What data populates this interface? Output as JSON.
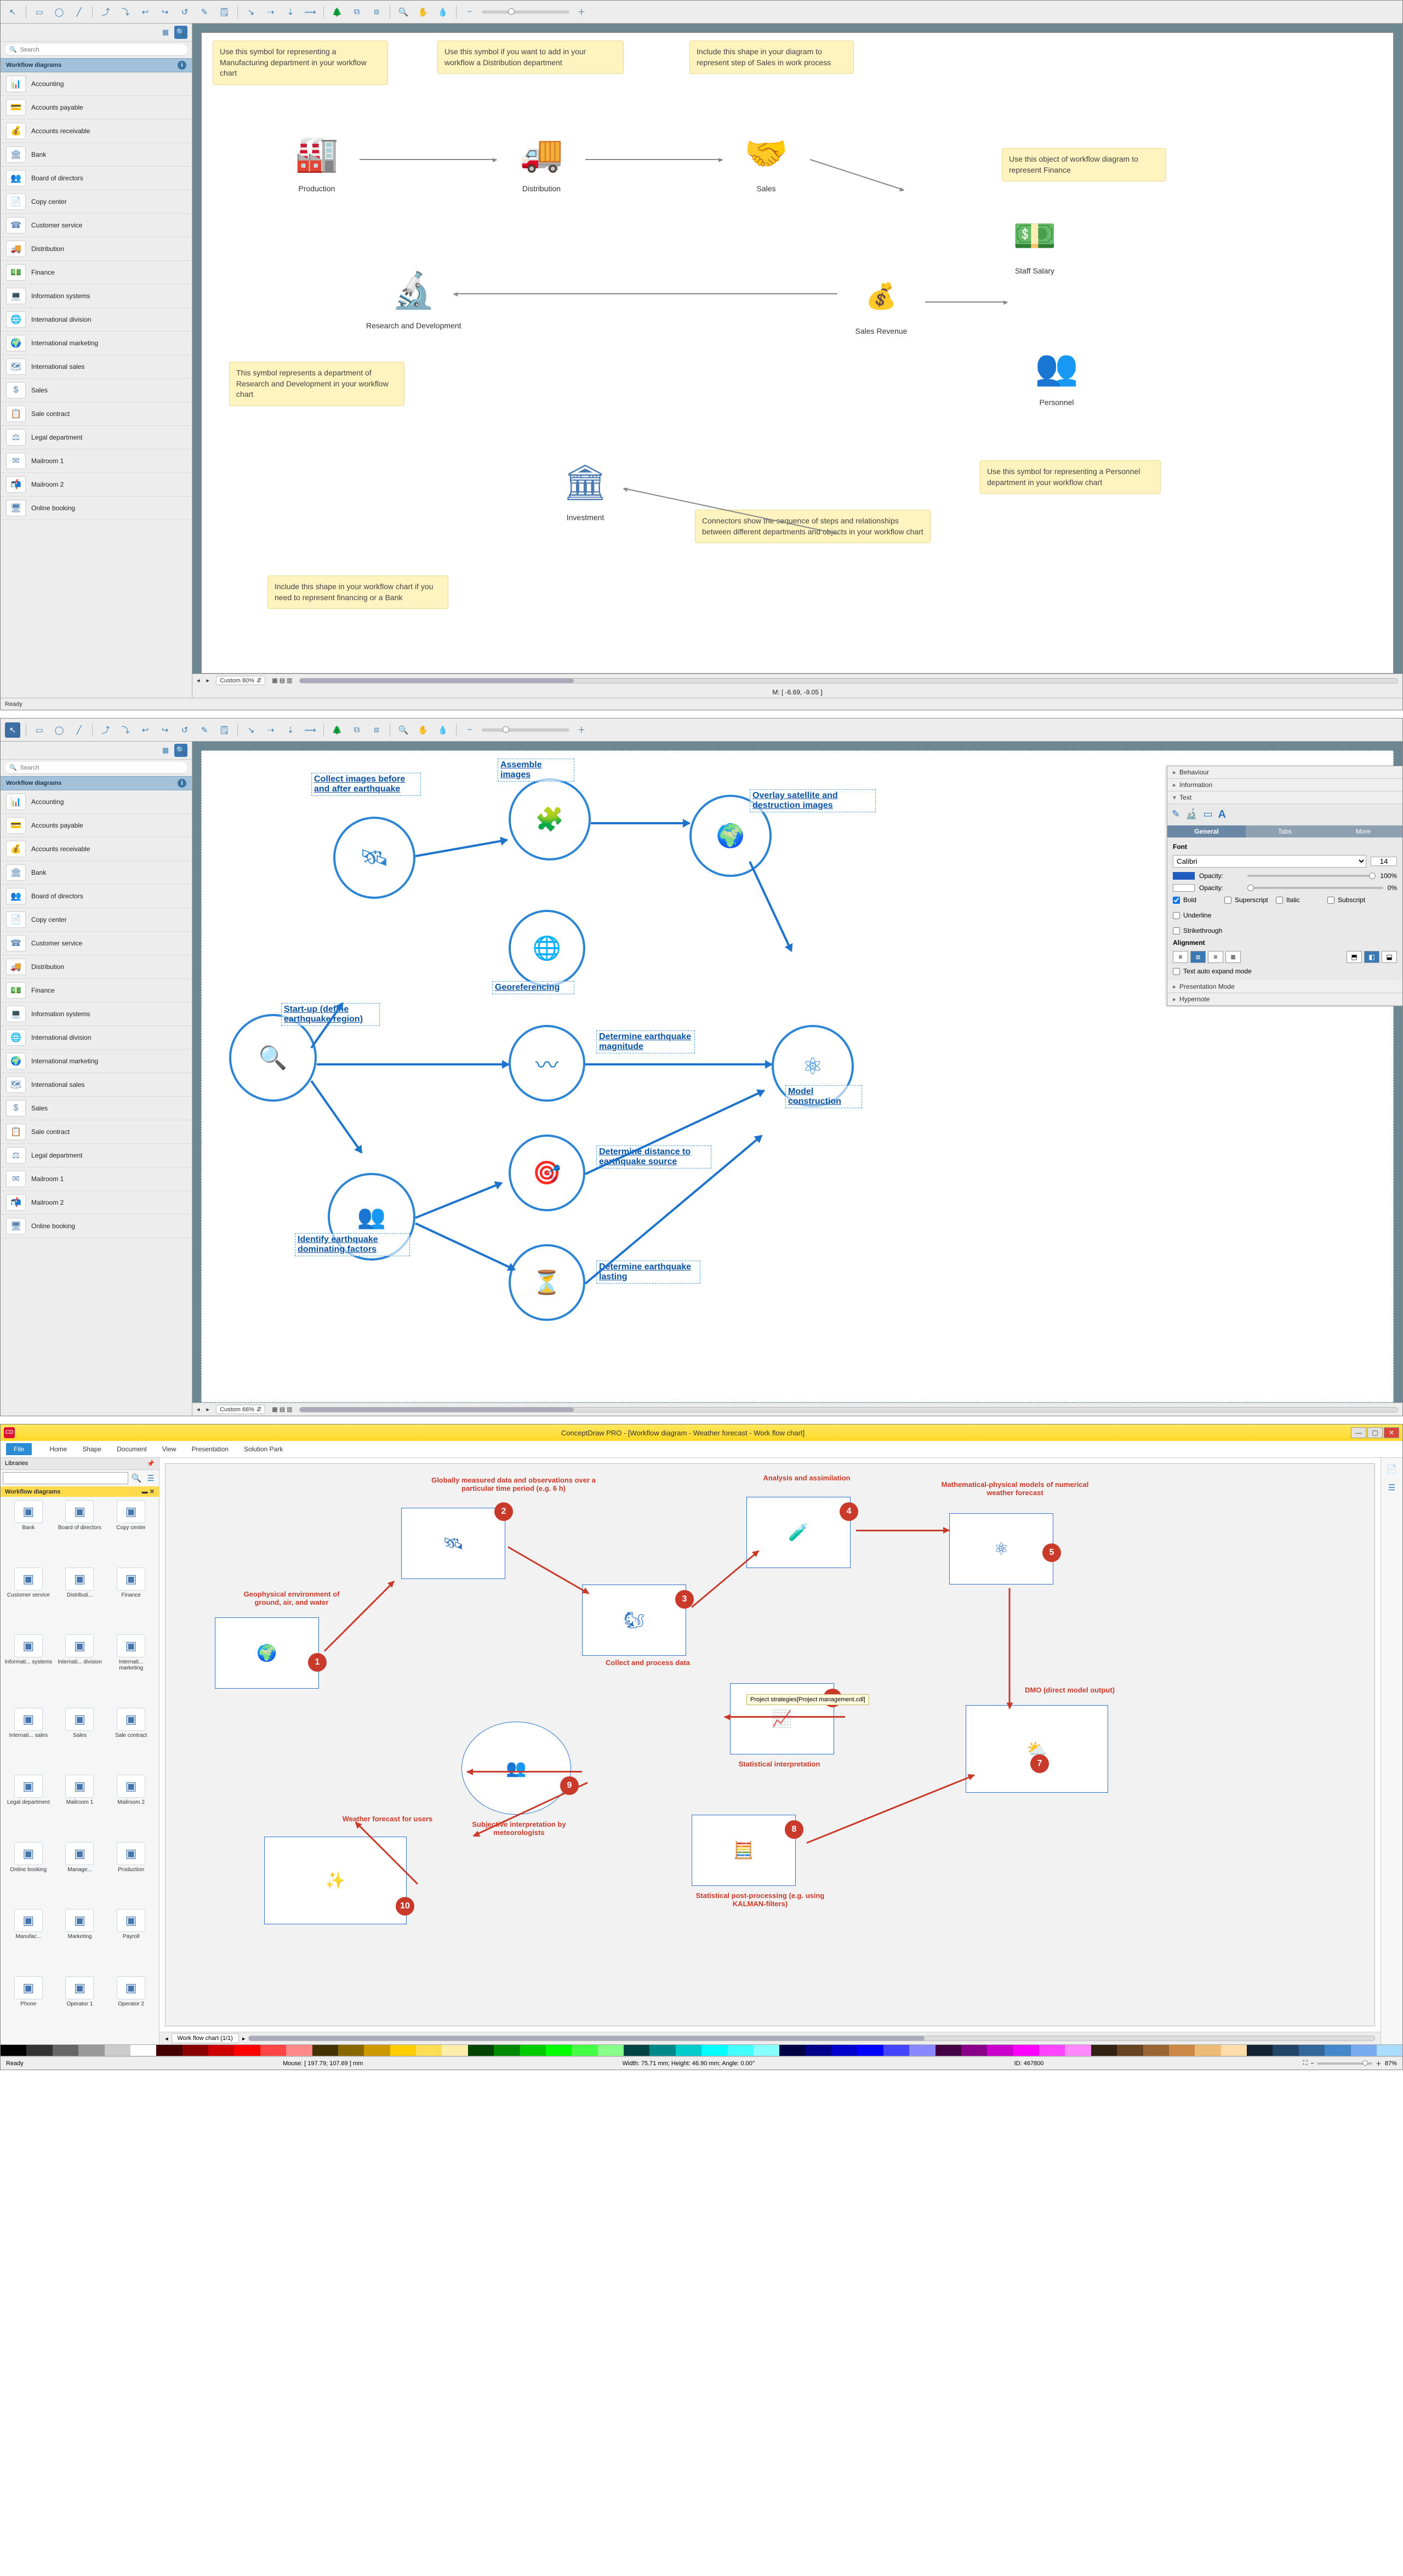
{
  "toolbar_icons": [
    "◻",
    "▭",
    "◯",
    "〰",
    "⤴",
    "⤵",
    "↩",
    "↪",
    "⟲",
    "✎",
    "⌑",
    "⌫",
    "↔",
    "↕",
    "⇄",
    "⇅",
    "＋",
    "✚",
    "⬚",
    "⌂",
    "◐",
    "◑",
    "✥",
    "⤡",
    "⤢",
    "−",
    "━",
    "＋"
  ],
  "sidebar": {
    "title": "Workflow diagrams",
    "search_placeholder": "Search",
    "items": [
      {
        "label": "Accounting",
        "icn": "📊"
      },
      {
        "label": "Accounts payable",
        "icn": "💳"
      },
      {
        "label": "Accounts receivable",
        "icn": "💰"
      },
      {
        "label": "Bank",
        "icn": "🏛"
      },
      {
        "label": "Board of directors",
        "icn": "👥"
      },
      {
        "label": "Copy center",
        "icn": "📄"
      },
      {
        "label": "Customer service",
        "icn": "☎"
      },
      {
        "label": "Distribution",
        "icn": "🚚"
      },
      {
        "label": "Finance",
        "icn": "💵"
      },
      {
        "label": "Information systems",
        "icn": "💻"
      },
      {
        "label": "International division",
        "icn": "🌐"
      },
      {
        "label": "International marketing",
        "icn": "🌍"
      },
      {
        "label": "International sales",
        "icn": "🗺"
      },
      {
        "label": "Sales",
        "icn": "$"
      },
      {
        "label": "Sale contract",
        "icn": "📋"
      },
      {
        "label": "Legal department",
        "icn": "⚖"
      },
      {
        "label": "Mailroom 1",
        "icn": "✉"
      },
      {
        "label": "Mailroom 2",
        "icn": "📬"
      },
      {
        "label": "Online booking",
        "icn": "🖥"
      }
    ]
  },
  "p1": {
    "zoom": "Custom 80%",
    "mouse_readout": "M: [ -6.69, -9.05 ]",
    "ready": "Ready",
    "callouts": {
      "c_prod": "Use this symbol for representing a Manufacturing department in your workflow chart",
      "c_dist": "Use this symbol if you want to add in your workflow a Distribution department",
      "c_sales": "Include this shape in your diagram to represent step of Sales in work process",
      "c_fin": "Use this object of workflow diagram to represent Finance",
      "c_rnd": "This symbol represents a department of Research and Development in your workflow chart",
      "c_bank": "Include this shape in your workflow chart if you need to represent financing or a Bank",
      "c_conn": "Connectors show the sequence of steps and relationships between different departments and objects in your workflow chart",
      "c_pers": "Use this symbol for representing a Personnel department in your workflow chart"
    },
    "nodes": {
      "production": "Production",
      "distribution": "Distribution",
      "sales": "Sales",
      "staff": "Staff Salary",
      "revenue": "Sales Revenue",
      "rnd": "Research and Development",
      "personnel": "Personnel",
      "invest": "Investment"
    }
  },
  "p2": {
    "zoom": "Custom 66%",
    "labels": {
      "collect": "Collect images before and after earthquake",
      "assemble": "Assemble images",
      "overlay": "Overlay satellite and destruction images",
      "georef": "Georeferencing",
      "startup": "Start-up (define earthquake region)",
      "magnitude": "Determine earthquake magnitude",
      "model": "Model construction",
      "distance": "Determine distance to earthquake source",
      "identify": "Identify earthquake dominating factors",
      "lasting": "Determine earthquake lasting"
    },
    "inspector": {
      "sections": [
        "Behaviour",
        "Information",
        "Text"
      ],
      "tabs": [
        "General",
        "Tabs",
        "More"
      ],
      "font_label": "Font",
      "font": "Calibri",
      "font_size": "14",
      "opacity_label": "Opacity:",
      "opacity_fill": "100%",
      "opacity_line": "0%",
      "checks": [
        "Bold",
        "Italic",
        "Underline",
        "Strikethrough"
      ],
      "checks2": [
        "Superscript",
        "Subscript"
      ],
      "align_label": "Alignment",
      "extras": [
        "Text auto expand mode",
        "Presentation Mode",
        "Hypernote"
      ]
    }
  },
  "p3": {
    "title": "ConceptDraw PRO - [Workflow diagram - Weather forecast - Work flow chart]",
    "app_btn": "CD",
    "menu": [
      "File",
      "Home",
      "Shape",
      "Document",
      "View",
      "Presentation",
      "Solution Park"
    ],
    "libraries_label": "Libraries",
    "lib_title": "Workflow diagrams",
    "grid": [
      "Bank",
      "Board of directors",
      "Copy center",
      "Customer service",
      "Distributi...",
      "Finance",
      "Informati... systems",
      "Internati... division",
      "Internati... marketing",
      "Internati... sales",
      "Sales",
      "Sale contract",
      "Legal department",
      "Mailroom 1",
      "Mailroom 2",
      "Online booking",
      "Manage...",
      "Production",
      "Manufac...",
      "Marketing",
      "Payroll",
      "Phone",
      "Operator 1",
      "Operator 2"
    ],
    "tab_label": "Work flow chart (1/1)",
    "nodes": {
      "n1": "Geophysical environment of ground, air, and water",
      "n2": "Globally measured data and observations over a particular time period (e.g. 6 h)",
      "n3": "Collect and process data",
      "n4": "Analysis and assimilation",
      "n5": "Mathematical-physical models of numerical weather forecast",
      "n6": "Statistical interpretation",
      "n7": "DMO (direct model output)",
      "n8": "Statistical post-processing (e.g. using KALMAN-filters)",
      "n9": "Subjective interpretation by meteorologists",
      "n10": "Weather forecast for users",
      "tooltip": "Project strategies[Project management.cdl]"
    },
    "footer": {
      "ready": "Ready",
      "mouse": "Mouse: [ 197.79; 107.69 ] mm",
      "size": "Width: 75.71 mm; Height: 46.90 mm; Angle: 0.00°",
      "id": "ID: 467800",
      "zoom": "87%"
    },
    "palette": [
      "#000",
      "#333",
      "#666",
      "#999",
      "#ccc",
      "#fff",
      "#400",
      "#800",
      "#c00",
      "#f00",
      "#f44",
      "#f88",
      "#430",
      "#860",
      "#c90",
      "#fc0",
      "#fd5",
      "#fea",
      "#040",
      "#080",
      "#0c0",
      "#0f0",
      "#4f4",
      "#8f8",
      "#044",
      "#088",
      "#0cc",
      "#0ff",
      "#4ff",
      "#8ff",
      "#004",
      "#008",
      "#00c",
      "#00f",
      "#44f",
      "#88f",
      "#404",
      "#808",
      "#c0c",
      "#f0f",
      "#f4f",
      "#f8f",
      "#321",
      "#642",
      "#963",
      "#c84",
      "#eb7",
      "#fda",
      "#123",
      "#246",
      "#369",
      "#48c",
      "#7ae",
      "#adf"
    ]
  }
}
